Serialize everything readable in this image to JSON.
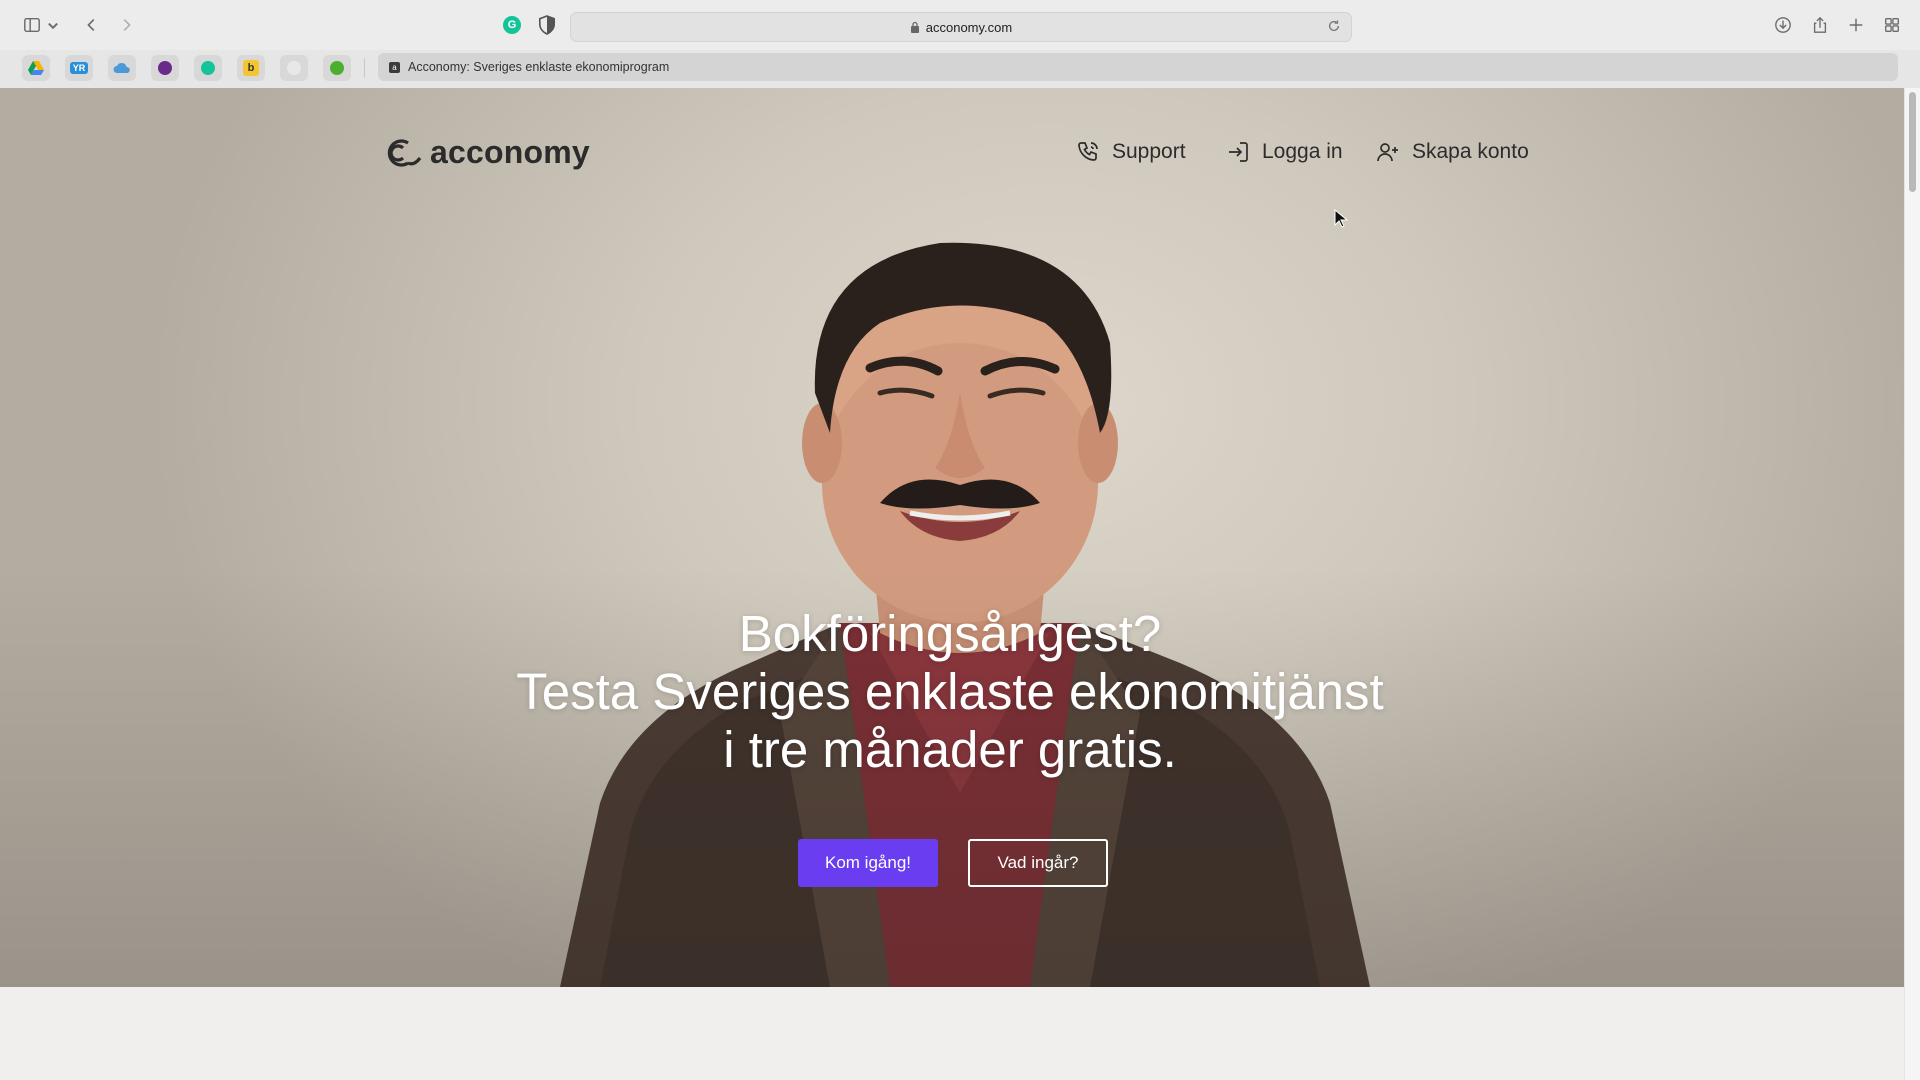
{
  "browser": {
    "url": "acconomy.com",
    "tab_title": "Acconomy: Sveriges enklaste ekonomiprogram",
    "bookmarks": [
      {
        "icon": "google-drive-icon",
        "color": "#f4b400"
      },
      {
        "icon": "yr-icon",
        "label": "YR",
        "color": "#2a8fd6"
      },
      {
        "icon": "cloud-icon",
        "color": "#4a9ad8"
      },
      {
        "icon": "purple-app-icon",
        "color": "#6a2a8a"
      },
      {
        "icon": "grammarly-icon",
        "color": "#15c39a"
      },
      {
        "icon": "b-icon",
        "label": "b",
        "color": "#f4c531"
      },
      {
        "icon": "blank-icon",
        "color": "#e8e8e8"
      },
      {
        "icon": "green-circle-icon",
        "color": "#4caf2e"
      }
    ]
  },
  "site": {
    "logo": "acconomy",
    "nav": {
      "support": "Support",
      "login": "Logga in",
      "signup": "Skapa konto"
    },
    "hero": {
      "line1": "Bokföringsångest?",
      "line2": "Testa Sveriges enklaste ekonomitjänst",
      "line3": "i tre månader gratis.",
      "primary_cta": "Kom igång!",
      "secondary_cta": "Vad ingår?"
    },
    "colors": {
      "accent": "#6a3df0"
    }
  }
}
